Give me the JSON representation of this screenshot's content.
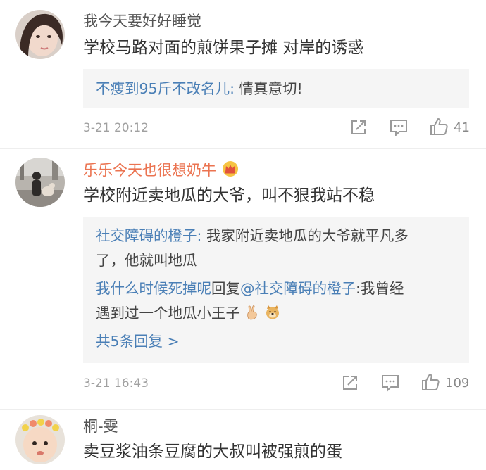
{
  "comments": [
    {
      "username": "我今天要好好睡觉",
      "text": "学校马路对面的煎饼果子摊 对岸的诱惑",
      "replies": [
        {
          "author": "不瘦到95斤不改名儿",
          "text": "情真意切!"
        }
      ],
      "time": "3-21 20:12",
      "likes": "41",
      "avatar_icon": "girl-portrait-avatar"
    },
    {
      "username": "乐乐今天也很想奶牛",
      "badge_icon": "crown-badge-icon",
      "text": "学校附近卖地瓜的大爷，叫不狠我站不稳",
      "replies": [
        {
          "author": "社交障碍的橙子",
          "text_line1": "我家附近卖地瓜的大爷就平凡多",
          "text_line2": "了，他就叫地瓜"
        },
        {
          "author": "我什么时候死掉呢",
          "mid": "回复",
          "mention": "@社交障碍的橙子",
          "text_line1": ":我曾经",
          "text_line2": "遇到过一个地瓜小王子"
        }
      ],
      "more_replies": "共5条回复 >",
      "time": "3-21 16:43",
      "likes": "109",
      "avatar_icon": "street-photo-avatar"
    },
    {
      "username": "桐-雯",
      "text": "卖豆浆油条豆腐的大叔叫被强煎的蛋",
      "avatar_icon": "baby-flower-crown-avatar"
    }
  ],
  "colors": {
    "link": "#4a7fb6",
    "vip_name": "#eb7350",
    "reply_bg": "#f5f5f5",
    "meta": "#a0a0a0"
  }
}
